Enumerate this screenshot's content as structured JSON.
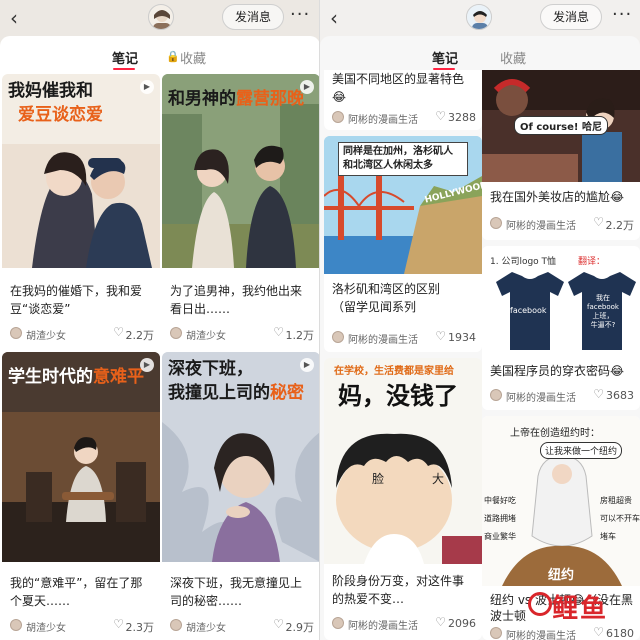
{
  "left": {
    "header": {
      "back_icon": "back-arrow-icon",
      "message_button": "发消息",
      "more_icon": "more-dots-icon"
    },
    "tabs": [
      {
        "label": "笔记"
      },
      {
        "label": "收藏",
        "icon": "lock-icon"
      }
    ],
    "cards": [
      {
        "cover_line1": "我妈催我和",
        "cover_line2": "爱豆谈恋爱",
        "caption_line1": "在我妈的催婚下，我和爱",
        "caption_line2": "豆“谈恋爱”",
        "author": "胡渣少女",
        "likes": "2.2万"
      },
      {
        "cover_line1": "和男神的",
        "cover_hl": "露营那晚",
        "caption_line1": "为了追男神，我约他出来",
        "caption_line2": "看日出……",
        "author": "胡渣少女",
        "likes": "1.2万"
      },
      {
        "cover_line1": "学生时代的",
        "cover_hl": "意难平",
        "caption_line1": "我的“意难平”，留在了那",
        "caption_line2": "个夏天……",
        "author": "胡渣少女",
        "likes": "2.3万"
      },
      {
        "cover_line1": "深夜下班，",
        "cover_line2a": "我撞见上司的",
        "cover_hl": "秘密",
        "caption_line1": "深夜下班，我无意撞见上",
        "caption_line2": "司的秘密……",
        "author": "胡渣少女",
        "likes": "2.9万"
      }
    ]
  },
  "right": {
    "header": {
      "back_icon": "back-arrow-icon",
      "message_button": "发消息",
      "more_icon": "more-dots-icon"
    },
    "tabs": [
      {
        "label": "笔记"
      },
      {
        "label": "收藏"
      }
    ],
    "cards": [
      {
        "caption_line1": "美国不同地区的显著特色",
        "author": "阿彬的漫画生活",
        "likes": "3288"
      },
      {
        "cover_line1": "同样是在加州，洛杉矶人",
        "cover_line2": "和北湾区人休闲太多",
        "cover_sign": "HOLLYWOOD",
        "caption_line1": "洛杉矶和湾区的区别",
        "caption_line2": "（留学见闻系列",
        "author": "阿彬的漫画生活",
        "likes": "1934"
      },
      {
        "cover_top": "在学校，生活费都是家里给",
        "cover_title": "妈，没钱了",
        "cover_face1": "脸",
        "cover_face2": "大",
        "caption_line1": "阶段身份万变，对这件事",
        "caption_line2": "的热爱不变…",
        "author": "阿彬的漫画生活",
        "likes": "2096"
      },
      {
        "cover_bubble": "Of course! 哈尼",
        "caption_line1": "我在国外美妆店的尴尬",
        "author": "阿彬的漫画生活",
        "likes": "2.2万"
      },
      {
        "cover_q": "1. 公司logo T恤",
        "cover_ans": "翻译：",
        "shirt1": "facebook",
        "shirt2_line1": "我在",
        "shirt2_line2": "facebook",
        "shirt2_line3": "上班，",
        "shirt2_line4": "牛逼不?",
        "caption_line1": "美国程序员的穿衣密码",
        "author": "阿彬的漫画生活",
        "likes": "3683"
      },
      {
        "cover_heading": "上帝在创造纽约时：",
        "bubble": "让我来做一个纽约",
        "tags_left": [
          "中餐好吃",
          "道路拥堵",
          "商业繁华"
        ],
        "tags_right": [
          "房租超贵",
          "可以不开车",
          "堵车"
        ],
        "ground": "纽约",
        "caption_line1": "纽约 vs 波士顿",
        "caption_line2": "（没在黑",
        "caption_line3": "波士顿",
        "author": "阿彬的漫画生活",
        "likes": "6180"
      }
    ]
  },
  "watermark": {
    "text": "鲤鱼"
  }
}
